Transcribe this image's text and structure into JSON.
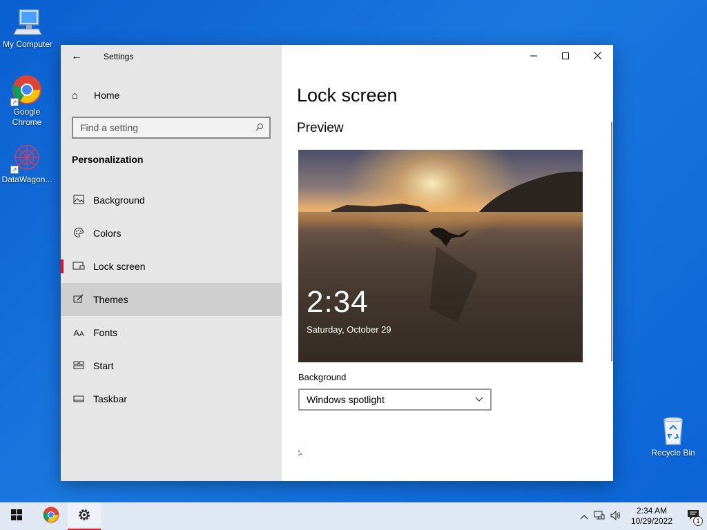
{
  "desktop": {
    "icons": [
      {
        "label": "My Computer"
      },
      {
        "label": "Google Chrome"
      },
      {
        "label": "DataWagon..."
      },
      {
        "label": "Recycle Bin"
      }
    ]
  },
  "window": {
    "app_title": "Settings",
    "nav": {
      "home_label": "Home",
      "search_placeholder": "Find a setting",
      "section_title": "Personalization",
      "items": [
        {
          "label": "Background",
          "icon": "image-icon"
        },
        {
          "label": "Colors",
          "icon": "palette-icon"
        },
        {
          "label": "Lock screen",
          "icon": "lock-screen-icon"
        },
        {
          "label": "Themes",
          "icon": "brush-icon"
        },
        {
          "label": "Fonts",
          "icon": "font-icon"
        },
        {
          "label": "Start",
          "icon": "start-icon"
        },
        {
          "label": "Taskbar",
          "icon": "taskbar-icon"
        }
      ],
      "active_item": "Lock screen",
      "hovered_item": "Themes"
    },
    "content": {
      "page_title": "Lock screen",
      "preview_title": "Preview",
      "preview_time": "2:34",
      "preview_date": "Saturday, October 29",
      "background_label": "Background",
      "background_value": "Windows spotlight"
    }
  },
  "taskbar": {
    "time": "2:34 AM",
    "date": "10/29/2022",
    "notification_count": "1"
  },
  "colors": {
    "accent": "#e81123",
    "nav_bg": "#e6e6e6",
    "desktop_bg": "#1a78e0"
  }
}
